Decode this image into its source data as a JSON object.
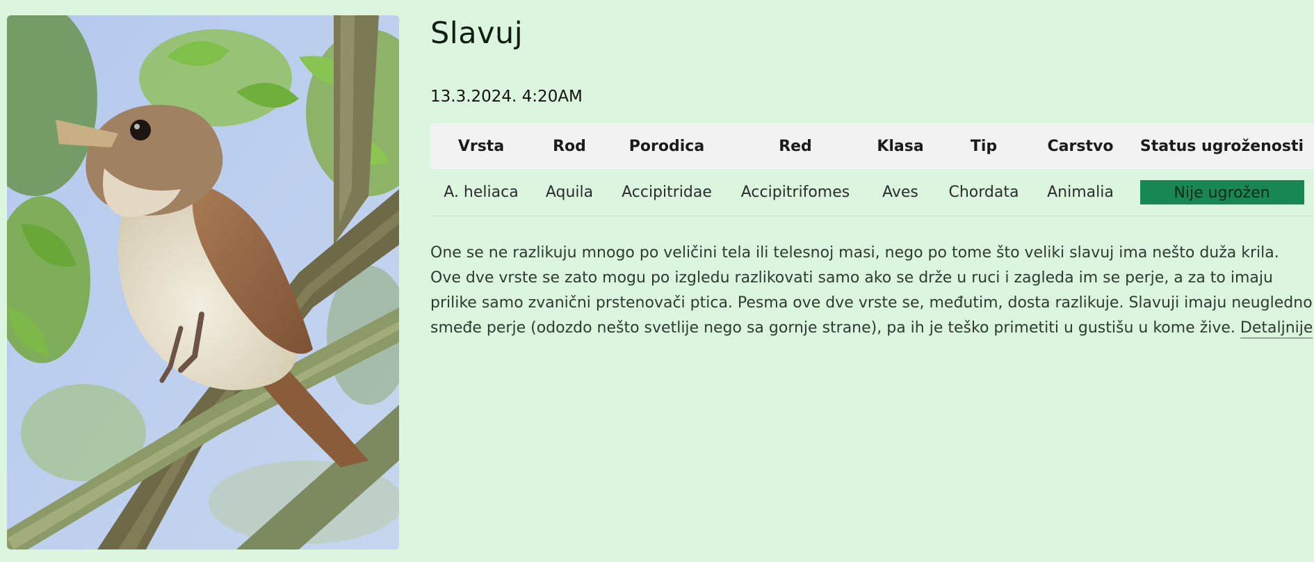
{
  "bird": {
    "name": "Slavuj",
    "date": "13.3.2024. 4:20AM",
    "image_alt": "Slavuj"
  },
  "taxonomy": {
    "headers": {
      "vrsta": "Vrsta",
      "rod": "Rod",
      "porodica": "Porodica",
      "red": "Red",
      "klasa": "Klasa",
      "tip": "Tip",
      "carstvo": "Carstvo",
      "status": "Status ugroženosti"
    },
    "values": {
      "vrsta": "A. heliaca",
      "rod": "Aquila",
      "porodica": "Accipitridae",
      "red": "Accipitrifomes",
      "klasa": "Aves",
      "tip": "Chordata",
      "carstvo": "Animalia",
      "status": "Nije ugrožen"
    },
    "status_color": "#198754"
  },
  "description": {
    "text": "One se ne razlikuju mnogo po veličini tela ili telesnoj masi, nego po tome što veliki slavuj ima nešto duža krila. Ove dve vrste se zato mogu po izgledu razlikovati samo ako se drže u ruci i zagleda im se perje, a za to imaju prilike samo zvanični prstenovači ptica. Pesma ove dve vrste se, međutim, dosta razlikuje. Slavuji imaju neugledno smeđe perje (odozdo nešto svetlije nego sa gornje strane), pa ih je teško primetiti u gustišu u kome žive. ",
    "link_label": "Detaljnije"
  },
  "colors": {
    "page_background": "#dcf5df",
    "header_background": "#f2f2f2",
    "badge": "#198754"
  }
}
